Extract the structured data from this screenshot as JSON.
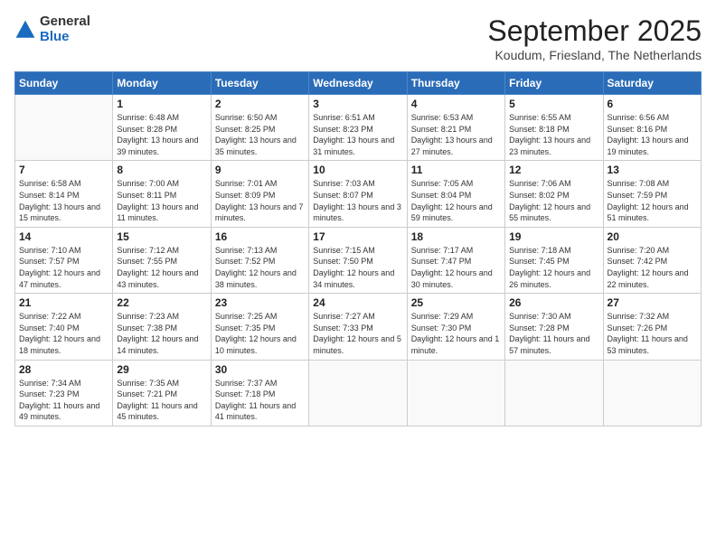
{
  "logo": {
    "general": "General",
    "blue": "Blue"
  },
  "header": {
    "month": "September 2025",
    "location": "Koudum, Friesland, The Netherlands"
  },
  "weekdays": [
    "Sunday",
    "Monday",
    "Tuesday",
    "Wednesday",
    "Thursday",
    "Friday",
    "Saturday"
  ],
  "weeks": [
    [
      {
        "day": "",
        "info": ""
      },
      {
        "day": "1",
        "info": "Sunrise: 6:48 AM\nSunset: 8:28 PM\nDaylight: 13 hours\nand 39 minutes."
      },
      {
        "day": "2",
        "info": "Sunrise: 6:50 AM\nSunset: 8:25 PM\nDaylight: 13 hours\nand 35 minutes."
      },
      {
        "day": "3",
        "info": "Sunrise: 6:51 AM\nSunset: 8:23 PM\nDaylight: 13 hours\nand 31 minutes."
      },
      {
        "day": "4",
        "info": "Sunrise: 6:53 AM\nSunset: 8:21 PM\nDaylight: 13 hours\nand 27 minutes."
      },
      {
        "day": "5",
        "info": "Sunrise: 6:55 AM\nSunset: 8:18 PM\nDaylight: 13 hours\nand 23 minutes."
      },
      {
        "day": "6",
        "info": "Sunrise: 6:56 AM\nSunset: 8:16 PM\nDaylight: 13 hours\nand 19 minutes."
      }
    ],
    [
      {
        "day": "7",
        "info": "Sunrise: 6:58 AM\nSunset: 8:14 PM\nDaylight: 13 hours\nand 15 minutes."
      },
      {
        "day": "8",
        "info": "Sunrise: 7:00 AM\nSunset: 8:11 PM\nDaylight: 13 hours\nand 11 minutes."
      },
      {
        "day": "9",
        "info": "Sunrise: 7:01 AM\nSunset: 8:09 PM\nDaylight: 13 hours\nand 7 minutes."
      },
      {
        "day": "10",
        "info": "Sunrise: 7:03 AM\nSunset: 8:07 PM\nDaylight: 13 hours\nand 3 minutes."
      },
      {
        "day": "11",
        "info": "Sunrise: 7:05 AM\nSunset: 8:04 PM\nDaylight: 12 hours\nand 59 minutes."
      },
      {
        "day": "12",
        "info": "Sunrise: 7:06 AM\nSunset: 8:02 PM\nDaylight: 12 hours\nand 55 minutes."
      },
      {
        "day": "13",
        "info": "Sunrise: 7:08 AM\nSunset: 7:59 PM\nDaylight: 12 hours\nand 51 minutes."
      }
    ],
    [
      {
        "day": "14",
        "info": "Sunrise: 7:10 AM\nSunset: 7:57 PM\nDaylight: 12 hours\nand 47 minutes."
      },
      {
        "day": "15",
        "info": "Sunrise: 7:12 AM\nSunset: 7:55 PM\nDaylight: 12 hours\nand 43 minutes."
      },
      {
        "day": "16",
        "info": "Sunrise: 7:13 AM\nSunset: 7:52 PM\nDaylight: 12 hours\nand 38 minutes."
      },
      {
        "day": "17",
        "info": "Sunrise: 7:15 AM\nSunset: 7:50 PM\nDaylight: 12 hours\nand 34 minutes."
      },
      {
        "day": "18",
        "info": "Sunrise: 7:17 AM\nSunset: 7:47 PM\nDaylight: 12 hours\nand 30 minutes."
      },
      {
        "day": "19",
        "info": "Sunrise: 7:18 AM\nSunset: 7:45 PM\nDaylight: 12 hours\nand 26 minutes."
      },
      {
        "day": "20",
        "info": "Sunrise: 7:20 AM\nSunset: 7:42 PM\nDaylight: 12 hours\nand 22 minutes."
      }
    ],
    [
      {
        "day": "21",
        "info": "Sunrise: 7:22 AM\nSunset: 7:40 PM\nDaylight: 12 hours\nand 18 minutes."
      },
      {
        "day": "22",
        "info": "Sunrise: 7:23 AM\nSunset: 7:38 PM\nDaylight: 12 hours\nand 14 minutes."
      },
      {
        "day": "23",
        "info": "Sunrise: 7:25 AM\nSunset: 7:35 PM\nDaylight: 12 hours\nand 10 minutes."
      },
      {
        "day": "24",
        "info": "Sunrise: 7:27 AM\nSunset: 7:33 PM\nDaylight: 12 hours\nand 5 minutes."
      },
      {
        "day": "25",
        "info": "Sunrise: 7:29 AM\nSunset: 7:30 PM\nDaylight: 12 hours\nand 1 minute."
      },
      {
        "day": "26",
        "info": "Sunrise: 7:30 AM\nSunset: 7:28 PM\nDaylight: 11 hours\nand 57 minutes."
      },
      {
        "day": "27",
        "info": "Sunrise: 7:32 AM\nSunset: 7:26 PM\nDaylight: 11 hours\nand 53 minutes."
      }
    ],
    [
      {
        "day": "28",
        "info": "Sunrise: 7:34 AM\nSunset: 7:23 PM\nDaylight: 11 hours\nand 49 minutes."
      },
      {
        "day": "29",
        "info": "Sunrise: 7:35 AM\nSunset: 7:21 PM\nDaylight: 11 hours\nand 45 minutes."
      },
      {
        "day": "30",
        "info": "Sunrise: 7:37 AM\nSunset: 7:18 PM\nDaylight: 11 hours\nand 41 minutes."
      },
      {
        "day": "",
        "info": ""
      },
      {
        "day": "",
        "info": ""
      },
      {
        "day": "",
        "info": ""
      },
      {
        "day": "",
        "info": ""
      }
    ]
  ]
}
